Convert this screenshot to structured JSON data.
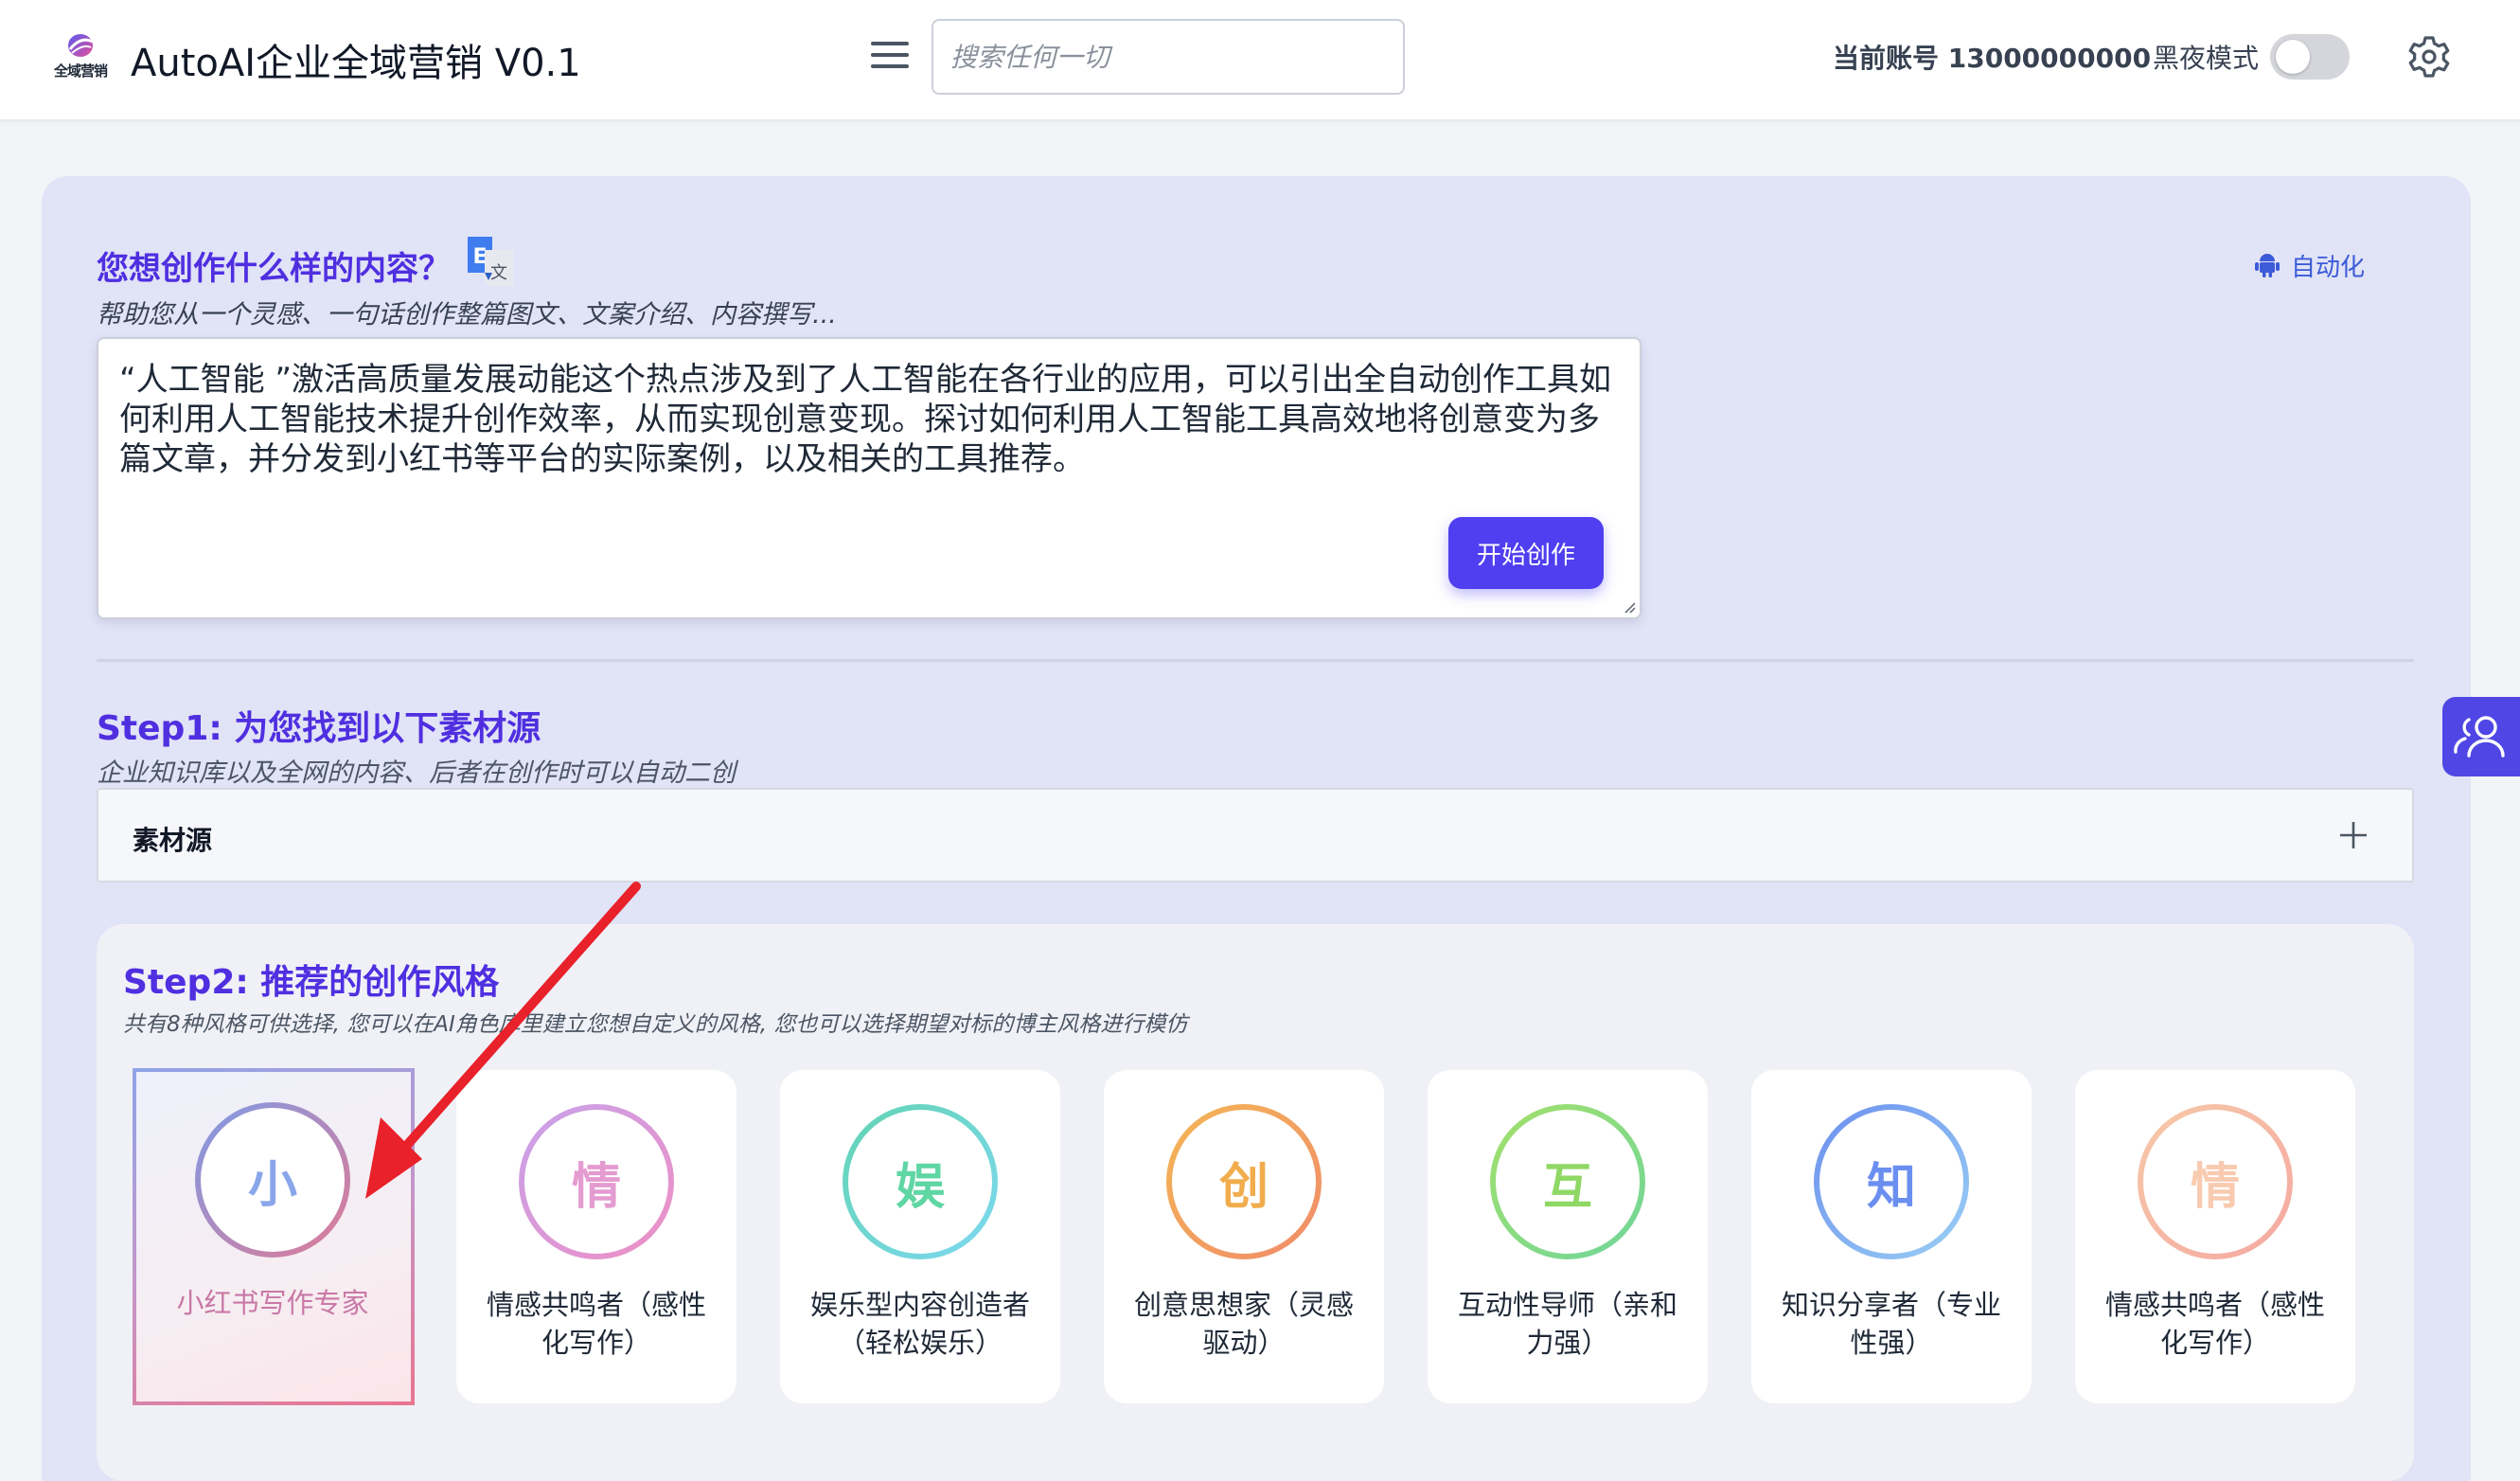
{
  "header": {
    "logo_text": "全域营销",
    "app_title": "AutoAI企业全域营销 V0.1",
    "search_placeholder": "搜索任何一切",
    "account": "当前账号 13000000000",
    "dark_mode_label": "黑夜模式",
    "dark_mode_on": false
  },
  "prompt_section": {
    "title": "您想创作什么样的内容？",
    "subtitle": "帮助您从一个灵感、一句话创作整篇图文、文案介绍、内容撰写...",
    "auto_label": "自动化",
    "prompt_text": "“人工智能 ”激活高质量发展动能这个热点涉及到了人工智能在各行业的应用，可以引出全自动创作工具如何利用人工智能技术提升创作效率，从而实现创意变现。探讨如何利用人工智能工具高效地将创意变为多篇文章，并分发到小红书等平台的实际案例，以及相关的工具推荐。",
    "start_button": "开始创作"
  },
  "step1": {
    "title": "Step1: 为您找到以下素材源",
    "subtitle": "企业知识库以及全网的内容、后者在创作时可以自动二创",
    "source_label": "素材源"
  },
  "step2": {
    "title": "Step2: 推荐的创作风格",
    "subtitle": "共有8种风格可供选择, 您可以在AI角色库里建立您想自定义的风格, 您也可以选择期望对标的博主风格进行模仿",
    "styles": [
      {
        "char": "小",
        "label": "小红书写作专家",
        "selected": true,
        "ring": [
          "#7f9be6",
          "#e07a95"
        ],
        "char_color": "#8aa6ea"
      },
      {
        "char": "情",
        "label": "情感共鸣者（感性化写作）",
        "selected": false,
        "ring": [
          "#c8a2ea",
          "#ee8fc4"
        ],
        "char_color": "#e49bd0"
      },
      {
        "char": "娱",
        "label": "娱乐型内容创造者（轻松娱乐）",
        "selected": false,
        "ring": [
          "#62d4b3",
          "#7dd8f0"
        ],
        "char_color": "#5fd6a3"
      },
      {
        "char": "创",
        "label": "创意思想家（灵感驱动）",
        "selected": false,
        "ring": [
          "#f4b654",
          "#f08b6b"
        ],
        "char_color": "#f1ad4d"
      },
      {
        "char": "互",
        "label": "互动性导师（亲和力强）",
        "selected": false,
        "ring": [
          "#a4e06a",
          "#6fd69b"
        ],
        "char_color": "#8fd865"
      },
      {
        "char": "知",
        "label": "知识分享者（专业性强）",
        "selected": false,
        "ring": [
          "#6c8fee",
          "#9ad0f4"
        ],
        "char_color": "#6b8ff0"
      },
      {
        "char": "情",
        "label": "情感共鸣者（感性化写作）",
        "selected": false,
        "ring": [
          "#f7c9a8",
          "#f5a8a2"
        ],
        "char_color": "#f8cbb0"
      }
    ]
  },
  "annotation": {
    "arrow_color": "#e8212b"
  }
}
